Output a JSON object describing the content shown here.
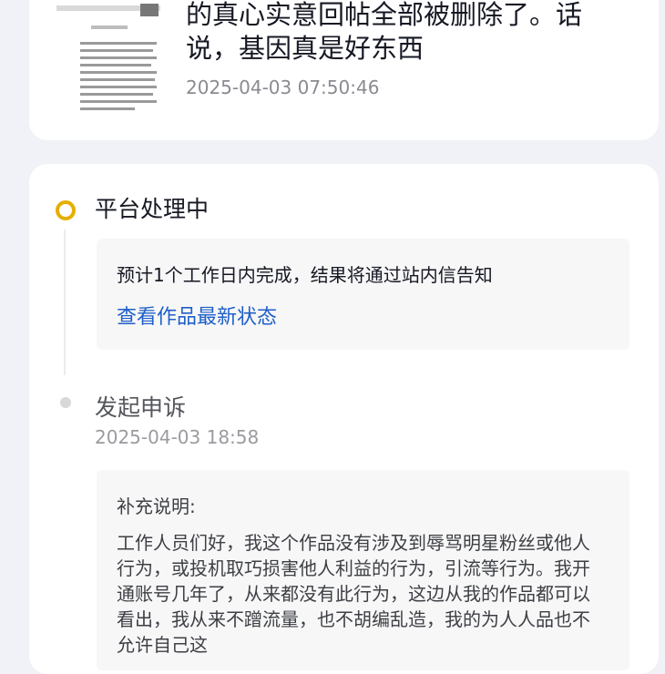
{
  "post": {
    "text": "的真心实意回帖全部被删除了。话说，基因真是好东西",
    "time": "2025-04-03 07:50:46"
  },
  "timeline": {
    "status": {
      "title": "平台处理中",
      "note": "预计1个工作日内完成，结果将通过站内信告知",
      "link": "查看作品最新状态"
    },
    "appeal": {
      "title": "发起申诉",
      "time": "2025-04-03 18:58",
      "supplement_label": "补充说明:",
      "supplement_text": "工作人员们好，我这个作品没有涉及到辱骂明星粉丝或他人行为，或投机取巧损害他人利益的行为，引流等行为。我开通账号几年了，从来都没有此行为，这边从我的作品都可以看出，我从来不蹭流量，也不胡编乱造，我的为人人品也不允许自己这"
    }
  },
  "colors": {
    "accent_status": "#e6ae00",
    "link": "#1f5fc9"
  }
}
